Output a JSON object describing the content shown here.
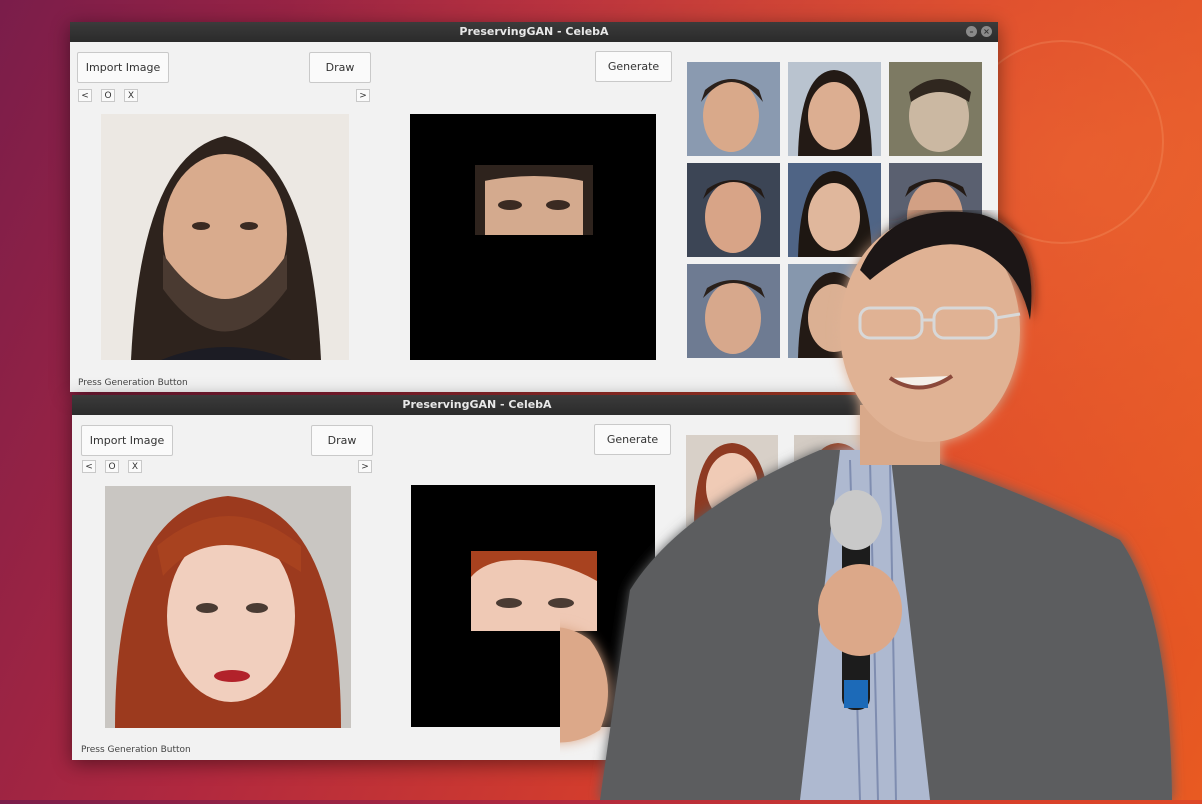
{
  "window_top": {
    "title": "PreservingGAN - CelebA",
    "import_label": "Import Image",
    "draw_label": "Draw",
    "generate_label": "Generate",
    "prev_label": "<",
    "reset_label": "O",
    "clear_label": "X",
    "next_label": ">",
    "status": "Press Generation Button"
  },
  "window_bottom": {
    "title": "PreservingGAN - CelebA",
    "import_label": "Import Image",
    "draw_label": "Draw",
    "generate_label": "Generate",
    "prev_label": "<",
    "reset_label": "O",
    "clear_label": "X",
    "next_label": ">",
    "status": "Press Generation Button"
  },
  "colors": {
    "desktop_start": "#7a1d4a",
    "desktop_end": "#e85a22",
    "titlebar": "#2b2b2b",
    "window_bg": "#f2f2f2"
  }
}
